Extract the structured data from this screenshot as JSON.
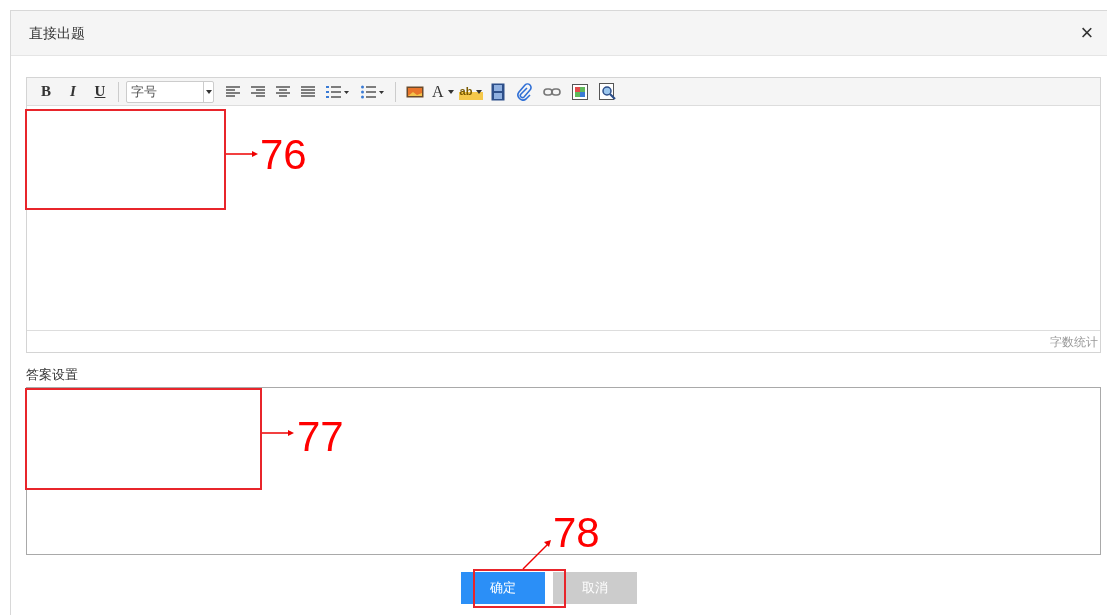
{
  "dialog": {
    "title": "直接出题",
    "close": "×"
  },
  "editor": {
    "toolbar": [
      {
        "kind": "bold",
        "label": "B"
      },
      {
        "kind": "italic",
        "label": "I"
      },
      {
        "kind": "underline",
        "label": "U"
      },
      {
        "kind": "separator"
      },
      {
        "kind": "select",
        "label": "字号"
      },
      {
        "kind": "align-left"
      },
      {
        "kind": "align-right"
      },
      {
        "kind": "align-center"
      },
      {
        "kind": "align-justify"
      },
      {
        "kind": "ordered-list"
      },
      {
        "kind": "bullet-list"
      },
      {
        "kind": "separator"
      },
      {
        "kind": "image"
      },
      {
        "kind": "text-dropdown",
        "label": "A"
      },
      {
        "kind": "highlight",
        "label": "ab"
      },
      {
        "kind": "film"
      },
      {
        "kind": "paperclip"
      },
      {
        "kind": "link"
      },
      {
        "kind": "picture-frame"
      },
      {
        "kind": "magnifier"
      }
    ],
    "status": "字数统计"
  },
  "answer_section": {
    "label": "答案设置"
  },
  "buttons": [
    {
      "label": "确定",
      "kind": "primary"
    },
    {
      "label": "取消",
      "kind": "disabled"
    }
  ],
  "annotations": [
    {
      "label": "76"
    },
    {
      "label": "77"
    },
    {
      "label": "78"
    }
  ]
}
